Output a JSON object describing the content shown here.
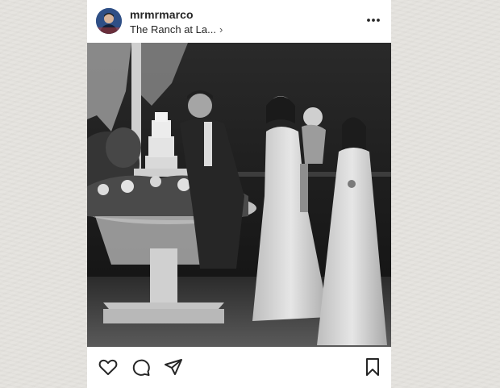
{
  "post": {
    "username": "mrmrmarco",
    "location": "The Ranch at La...",
    "location_chevron": "›"
  },
  "icons": {
    "more": "more-options-icon",
    "like": "heart-icon",
    "comment": "comment-icon",
    "share": "share-icon",
    "save": "bookmark-icon"
  },
  "colors": {
    "text": "#262626",
    "card_background": "#ffffff",
    "page_background": "#e6e4df"
  }
}
